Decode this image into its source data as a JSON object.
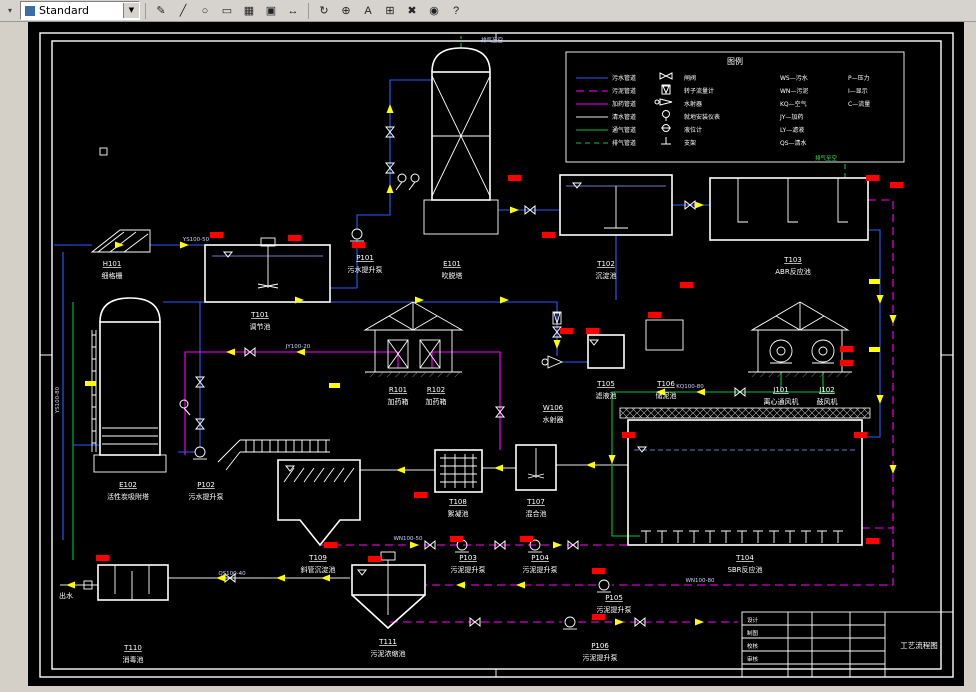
{
  "toolbar": {
    "style_value": "Standard",
    "icons": [
      {
        "name": "draw",
        "glyph": "✎"
      },
      {
        "name": "polyline",
        "glyph": "╱"
      },
      {
        "name": "circle",
        "glyph": "○"
      },
      {
        "name": "rectangle",
        "glyph": "▭"
      },
      {
        "name": "hatch",
        "glyph": "▦"
      },
      {
        "name": "layers",
        "glyph": "▣"
      },
      {
        "name": "move",
        "glyph": "↔"
      },
      {
        "name": "rotate",
        "glyph": "↻"
      },
      {
        "name": "osnap",
        "glyph": "⊕"
      },
      {
        "name": "text",
        "glyph": "A"
      },
      {
        "name": "grid",
        "glyph": "⊞"
      },
      {
        "name": "erase",
        "glyph": "✖"
      },
      {
        "name": "zoom",
        "glyph": "◉"
      },
      {
        "name": "help",
        "glyph": "?"
      }
    ]
  },
  "legend": {
    "title": "图例",
    "lines": [
      {
        "label": "污水管道"
      },
      {
        "label": "污泥管道"
      },
      {
        "label": "加药管道"
      },
      {
        "label": "清水管道"
      },
      {
        "label": "通气管道"
      },
      {
        "label": "排气管道"
      }
    ],
    "symbols": [
      {
        "label": "闸阀"
      },
      {
        "label": "转子流量计"
      },
      {
        "label": "水射器"
      },
      {
        "label": "就地安装仪表"
      },
      {
        "label": "液位计"
      },
      {
        "label": "支架"
      }
    ],
    "abbr_left": [
      "WS—污水",
      "WN—污泥",
      "KQ—空气",
      "JY—加药",
      "LY—滤液",
      "QS—清水"
    ],
    "abbr_right": [
      "P—压力",
      "I—显示",
      "C—流量"
    ]
  },
  "equipment": {
    "h101": {
      "id": "H101",
      "name": "细格栅"
    },
    "t101": {
      "id": "T101",
      "name": "调节池"
    },
    "p101": {
      "id": "P101",
      "name": "污水提升泵"
    },
    "e101": {
      "id": "E101",
      "name": "吹脱塔"
    },
    "t102": {
      "id": "T102",
      "name": "沉淀池"
    },
    "t103": {
      "id": "T103",
      "name": "ABR反应池"
    },
    "r101": {
      "id": "R101",
      "name": "加药箱"
    },
    "r102": {
      "id": "R102",
      "name": "加药箱"
    },
    "w106": {
      "id": "W106",
      "name": "水射器"
    },
    "t105": {
      "id": "T105",
      "name": "滤液池"
    },
    "t106": {
      "id": "T106",
      "name": "储泥池"
    },
    "j101": {
      "id": "J101",
      "name": "离心通风机"
    },
    "j102": {
      "id": "J102",
      "name": "鼓风机"
    },
    "e102": {
      "id": "E102",
      "name": "活性炭吸附塔"
    },
    "p102": {
      "id": "P102",
      "name": "污水提升泵"
    },
    "t109": {
      "id": "T109",
      "name": "斜管沉淀池"
    },
    "t108": {
      "id": "T108",
      "name": "絮凝池"
    },
    "t107": {
      "id": "T107",
      "name": "混合池"
    },
    "t104": {
      "id": "T104",
      "name": "SBR反应池"
    },
    "t110": {
      "id": "T110",
      "name": "消毒池"
    },
    "t111": {
      "id": "T111",
      "name": "污泥浓缩池"
    },
    "p103": {
      "id": "P103",
      "name": "污泥提升泵"
    },
    "p104": {
      "id": "P104",
      "name": "污泥提升泵"
    },
    "p105": {
      "id": "P105",
      "name": "污泥提升泵"
    },
    "p106": {
      "id": "P106",
      "name": "污泥提升泵"
    }
  },
  "tags": {
    "ys_main": "YS100-50",
    "ys_vert": "YS100-80",
    "jy": "JY100-20",
    "wn_mid": "WN100-50",
    "wn_bottom": "WN100-80",
    "kq": "KQ100-80",
    "qs": "QS100-40",
    "vent_top": "排气至空",
    "vent_right": "排气至空",
    "outflow": "出水"
  },
  "title_block": {
    "r1": "设计",
    "r2": "制图",
    "r3": "校核",
    "r4": "审核",
    "title": "工艺流程图"
  },
  "colors": {
    "sewage": "#2e5bff",
    "sludge": "#ff00ff",
    "air": "#00c33c",
    "highlight": "#ff0000",
    "arrow": "#ffff00"
  }
}
